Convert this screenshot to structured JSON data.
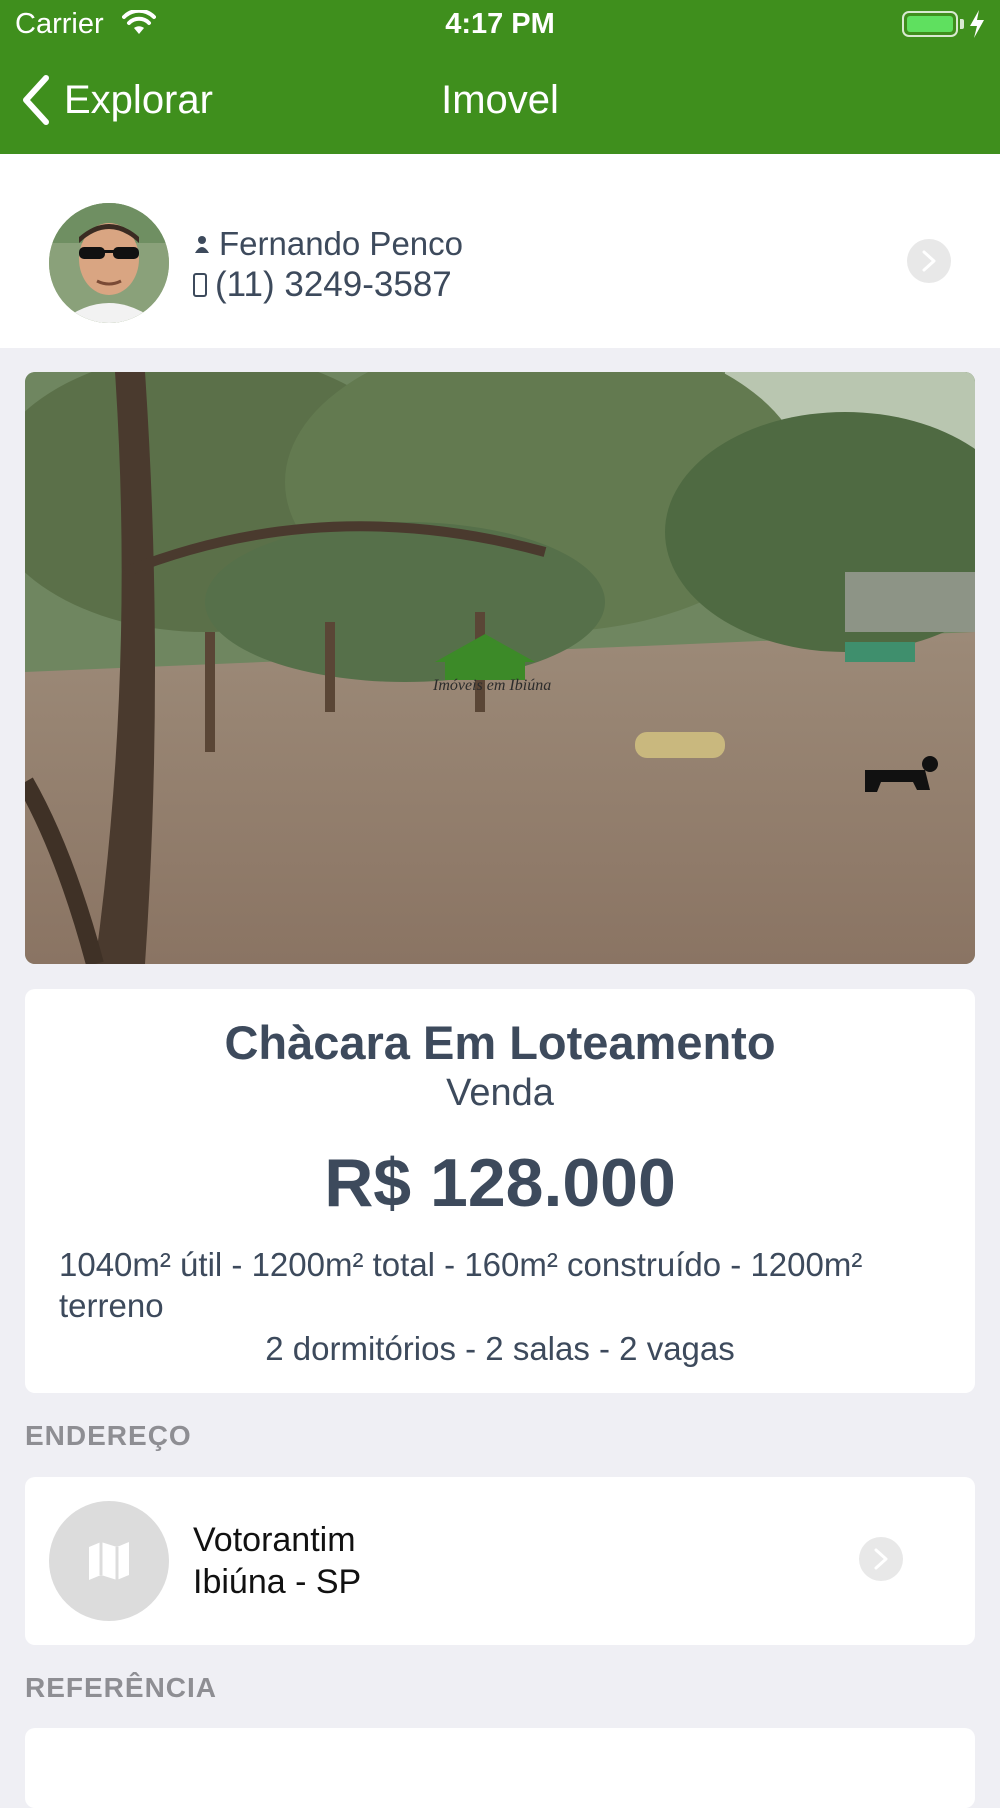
{
  "status_bar": {
    "carrier": "Carrier",
    "time": "4:17 PM",
    "battery_icon": "battery-icon"
  },
  "nav": {
    "back_label": "Explorar",
    "title": "Imovel"
  },
  "agent": {
    "name": "Fernando Penco",
    "phone": "(11) 3249-3587"
  },
  "photo": {
    "watermark_text": "Imóveis em Ibiúna"
  },
  "property": {
    "title": "Chàcara Em Loteamento",
    "transaction": "Venda",
    "price": "R$ 128.000",
    "areas": "1040m² útil - 1200m² total - 160m² construído - 1200m² terreno",
    "rooms": "2 dormitórios - 2 salas - 2 vagas"
  },
  "address_section": {
    "label": "ENDEREÇO",
    "line1": "Votorantim",
    "line2": "Ibiúna - SP"
  },
  "reference_section": {
    "label": "REFERÊNCIA"
  },
  "colors": {
    "nav_green": "#3f8f1d",
    "text": "#3d4a5c",
    "background": "#efeff4"
  }
}
